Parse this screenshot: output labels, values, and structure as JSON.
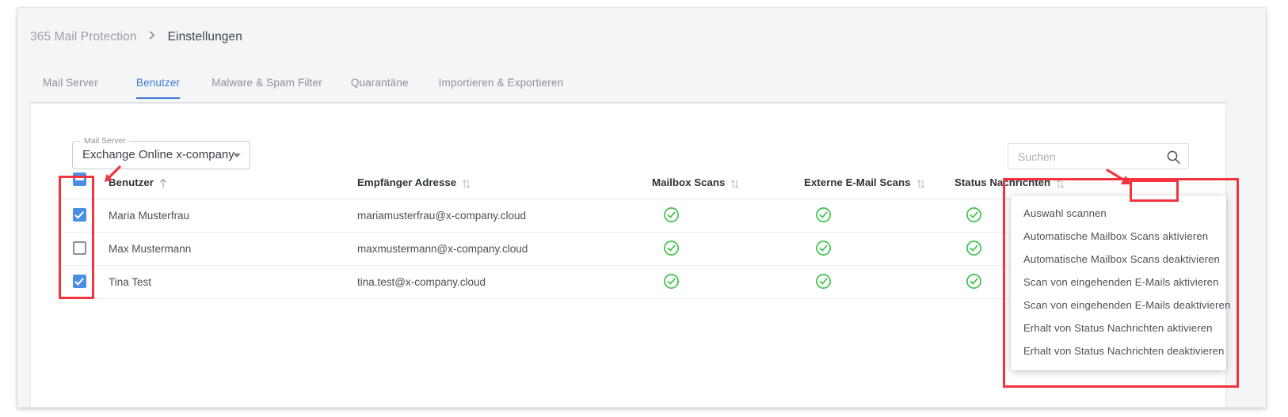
{
  "breadcrumb": {
    "root": "365 Mail Protection",
    "separator_icon": "chevron-right-icon",
    "current": "Einstellungen"
  },
  "tabs": [
    {
      "label": "Mail Server",
      "active": false
    },
    {
      "label": "Benutzer",
      "active": true
    },
    {
      "label": "Malware & Spam Filter",
      "active": false
    },
    {
      "label": "Quarantäne",
      "active": false
    },
    {
      "label": "Importieren & Exportieren",
      "active": false
    }
  ],
  "mail_server_select": {
    "legend": "Mail Server",
    "value": "Exchange Online x-company",
    "caret_icon": "chevron-down-icon"
  },
  "search": {
    "placeholder": "Suchen",
    "value": "",
    "icon": "search-icon"
  },
  "table": {
    "headers": [
      {
        "label": "",
        "sort": "none",
        "key": "select"
      },
      {
        "label": "Benutzer",
        "sort": "asc",
        "key": "user"
      },
      {
        "label": "Empfänger Adresse",
        "sort": "both",
        "key": "address"
      },
      {
        "label": "Mailbox Scans",
        "sort": "both",
        "key": "mailbox_scans"
      },
      {
        "label": "Externe E-Mail Scans",
        "sort": "both",
        "key": "external_scans"
      },
      {
        "label": "Status Nachrichten",
        "sort": "both",
        "key": "status_messages"
      },
      {
        "label": "",
        "sort": "none",
        "key": "menu"
      }
    ],
    "select_all_state": "indeterminate",
    "rows": [
      {
        "selected": true,
        "user": "Maria Musterfrau",
        "address": "mariamusterfrau@x-company.cloud",
        "mailbox_scans": "check-circle-icon",
        "external_scans": "check-circle-icon",
        "status_messages": "check-circle-icon"
      },
      {
        "selected": false,
        "user": "Max Mustermann",
        "address": "maxmustermann@x-company.cloud",
        "mailbox_scans": "check-circle-icon",
        "external_scans": "check-circle-icon",
        "status_messages": "check-circle-icon"
      },
      {
        "selected": true,
        "user": "Tina Test",
        "address": "tina.test@x-company.cloud",
        "mailbox_scans": "check-circle-icon",
        "external_scans": "check-circle-icon",
        "status_messages": "check-circle-icon"
      }
    ],
    "overflow_menu_icon": "ellipsis-icon"
  },
  "context_menu": {
    "items": [
      "Auswahl scannen",
      "Automatische Mailbox Scans aktivieren",
      "Automatische Mailbox Scans deaktivieren",
      "Scan von eingehenden E-Mails aktivieren",
      "Scan von eingehenden E-Mails deaktivieren",
      "Erhalt von Status Nachrichten aktivieren",
      "Erhalt von Status Nachrichten deaktivieren"
    ]
  },
  "annotations": {
    "highlight_color": "#f5333f",
    "boxes": [
      {
        "name": "checkbox-column-highlight"
      },
      {
        "name": "overflow-menu-highlight"
      },
      {
        "name": "context-menu-highlight"
      }
    ],
    "arrows": [
      {
        "name": "arrow-to-checkbox-column"
      },
      {
        "name": "arrow-to-overflow-menu"
      }
    ]
  },
  "colors": {
    "accent": "#3c7cd4",
    "checkbox": "#4a90e2",
    "success": "#3cc34b",
    "annotation": "#f5333f"
  }
}
